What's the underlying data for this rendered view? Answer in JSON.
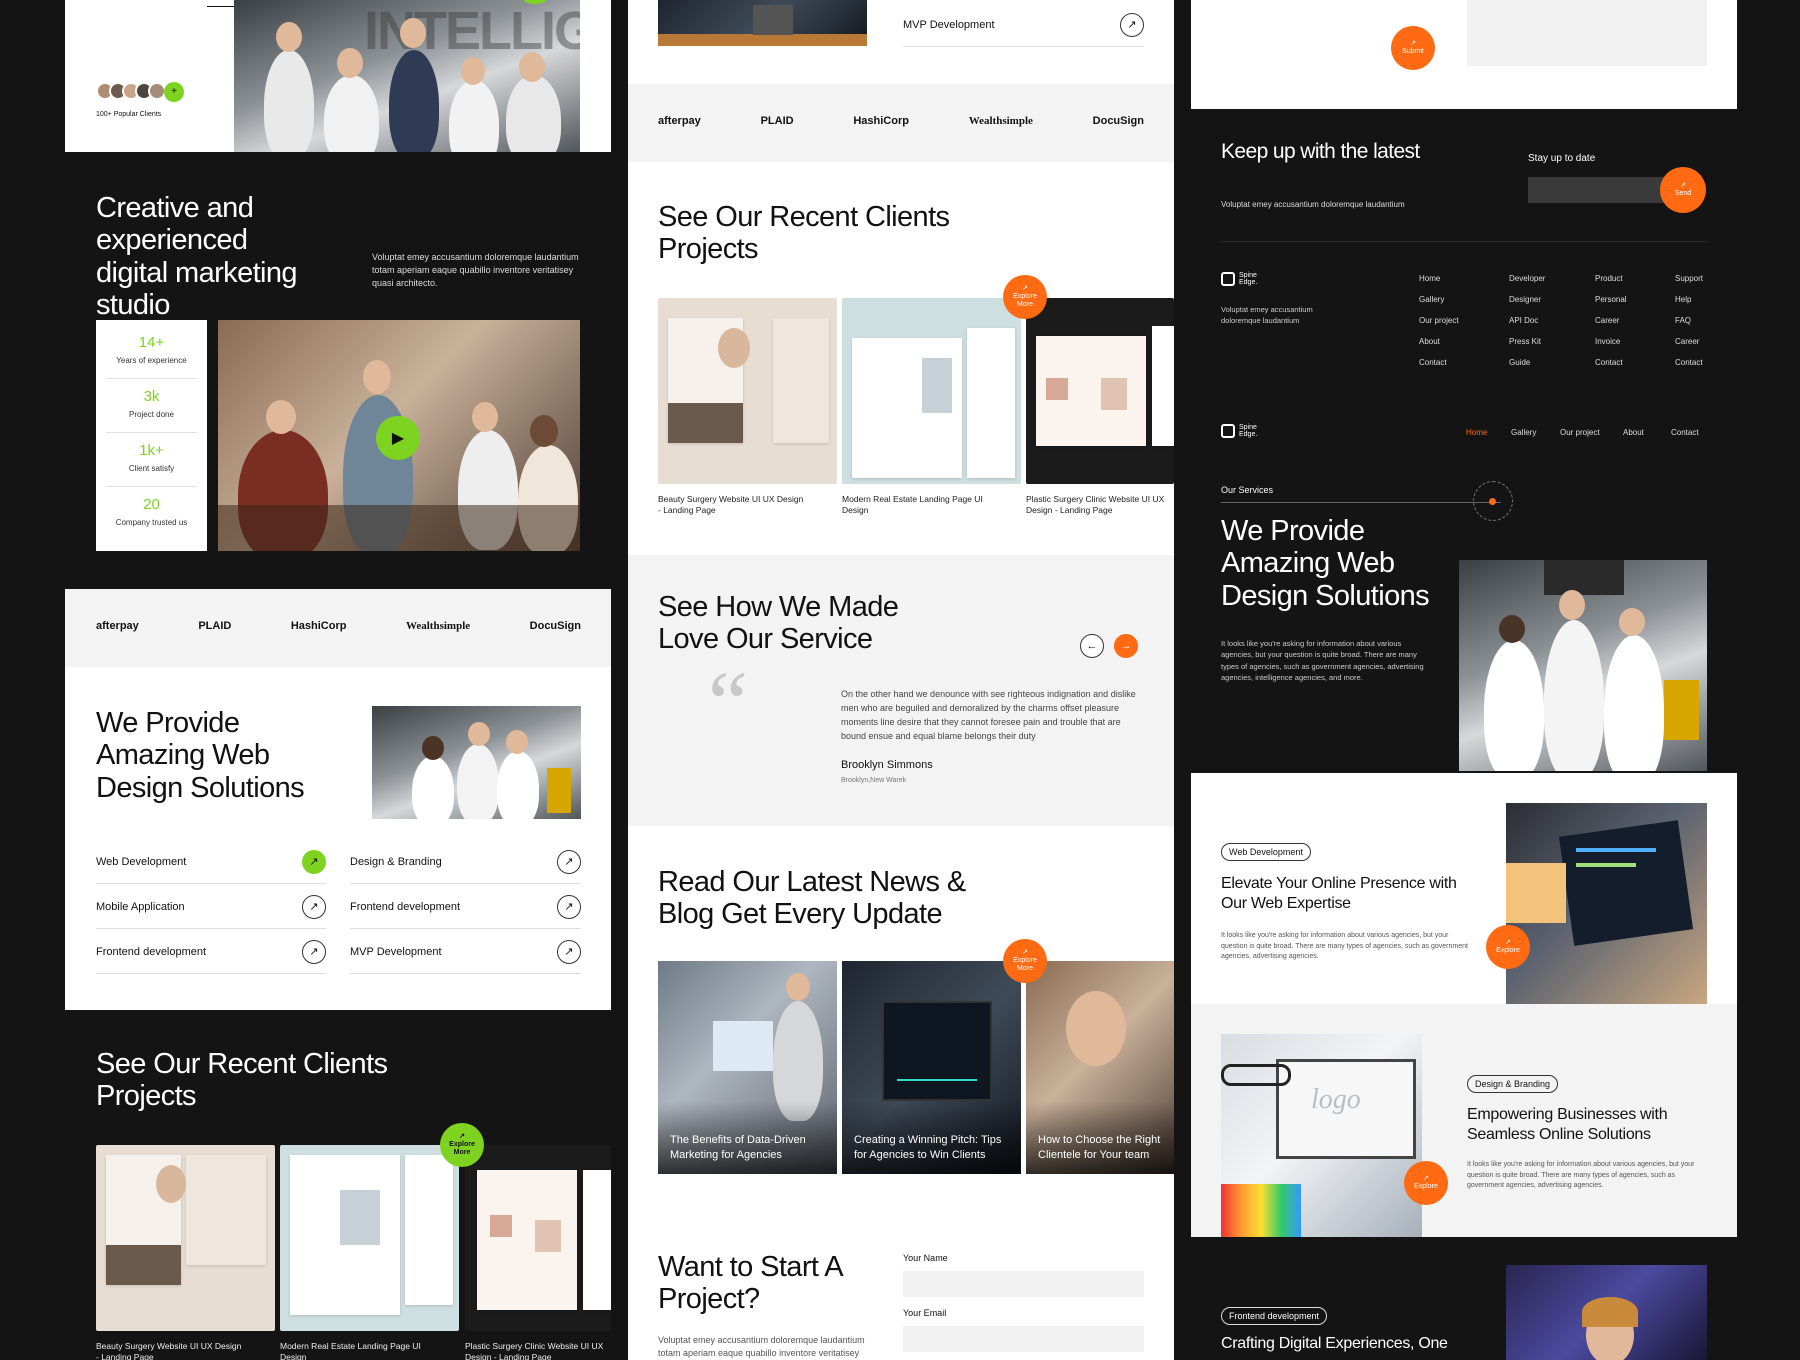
{
  "col1": {
    "hero": {
      "clients_label": "100+ Popular Clients"
    },
    "studio": {
      "title": "Creative and experienced digital marketing studio",
      "desc": "Voluptat emey accusantium doloremque laudantium totam aperiam eaque quabillo inventore veritatisey quasi architecto.",
      "stats": [
        {
          "value": "14+",
          "label": "Years of experience"
        },
        {
          "value": "3k",
          "label": "Project done"
        },
        {
          "value": "1k+",
          "label": "Client satisfy"
        },
        {
          "value": "20",
          "label": "Company trusted us"
        }
      ]
    },
    "logos": [
      "afterpay",
      "PLAID",
      "HashiCorp",
      "Wealthsimple",
      "DocuSign"
    ],
    "services": {
      "title": "We Provide Amazing Web Design Solutions",
      "left": [
        "Web Development",
        "Mobile Application",
        "Frontend development"
      ],
      "right": [
        "Design & Branding",
        "Frontend development",
        "MVP Development"
      ]
    },
    "projects": {
      "title": "See Our Recent Clients Projects",
      "explore": "Explore More",
      "items": [
        "Beauty Surgery Website UI UX Design - Landing Page",
        "Modern Real Estate Landing Page UI Design",
        "Plastic Surgery Clinic Website UI UX Design - Landing Page"
      ]
    }
  },
  "col2": {
    "top_service": "MVP Development",
    "logos": [
      "afterpay",
      "PLAID",
      "HashiCorp",
      "Wealthsimple",
      "DocuSign"
    ],
    "projects": {
      "title": "See Our Recent Clients Projects",
      "explore": "Explore More",
      "items": [
        "Beauty Surgery Website UI UX Design - Landing Page",
        "Modern Real Estate Landing Page UI Design",
        "Plastic Surgery Clinic Website UI UX Design - Landing Page"
      ]
    },
    "testimonial": {
      "title": "See How We Made Love Our Service",
      "quote": "On the other hand we denounce with see righteous indignation and dislike men who are beguiled and demoralized by the charms offset pleasure moments line desire that they cannot foresee pain and trouble that are bound ensue and equal blame belongs their duty",
      "name": "Brooklyn Simmons",
      "location": "Brooklyn,New Warek"
    },
    "news": {
      "title": "Read Our Latest News & Blog Get Every Update",
      "explore": "Explore More",
      "items": [
        "The Benefits of Data-Driven Marketing for Agencies",
        "Creating a Winning Pitch: Tips for Agencies to Win Clients",
        "How to Choose the Right Clientele for Your team"
      ]
    },
    "contact": {
      "title": "Want to Start A Project?",
      "desc": "Voluptat emey accusantium doloremque laudantium totam aperiam eaque quabillo inventore veritatisey",
      "name_label": "Your Name",
      "email_label": "Your Email"
    }
  },
  "col3": {
    "submit": "Submit",
    "newsletter": {
      "title": "Keep up with the latest",
      "desc": "Voluptat emey accusantium doloremque laudantium",
      "stay": "Stay up to date",
      "send": "Send"
    },
    "footer": {
      "brand": "Spine Edge.",
      "desc": "Voluptat emey accusantium doloremque laudantium",
      "cols": [
        [
          "Home",
          "Gallery",
          "Our project",
          "About",
          "Contact"
        ],
        [
          "Developer",
          "Designer",
          "API Doc",
          "Press Kit",
          "Guide"
        ],
        [
          "Product",
          "Personal",
          "Career",
          "Invoice",
          "Contact"
        ],
        [
          "Support",
          "Help",
          "FAQ",
          "Career",
          "Contact"
        ]
      ]
    },
    "nav": {
      "brand": "Spine Edge.",
      "items": [
        "Home",
        "Gallery",
        "Our project",
        "About",
        "Contact"
      ]
    },
    "services": {
      "eyebrow": "Our Services",
      "title": "We Provide Amazing Web Design Solutions",
      "desc": "It looks like you're asking for information about various agencies, but your question is quite broad. There are many types of agencies, such as government agencies, advertising agencies, intelligence agencies, and more."
    },
    "cards": [
      {
        "tag": "Web Development",
        "title": "Elevate Your Online Presence with Our Web Expertise",
        "desc": "It looks like you're asking for information about various agencies, but your question is quite broad. There are many types of agencies, such as government agencies, advertising agencies.",
        "explore": "Explore"
      },
      {
        "tag": "Design & Branding",
        "title": "Empowering Businesses with Seamless Online Solutions",
        "desc": "It looks like you're asking for information about various agencies, but your question is quite broad. There are many types of agencies, such as government agencies, advertising agencies.",
        "explore": "Explore"
      },
      {
        "tag": "Frontend development",
        "title": "Crafting Digital Experiences, One"
      }
    ]
  },
  "colors": {
    "accent_orange": "#ff6a13",
    "accent_green": "#7ed321",
    "bg_dark": "#141414"
  }
}
